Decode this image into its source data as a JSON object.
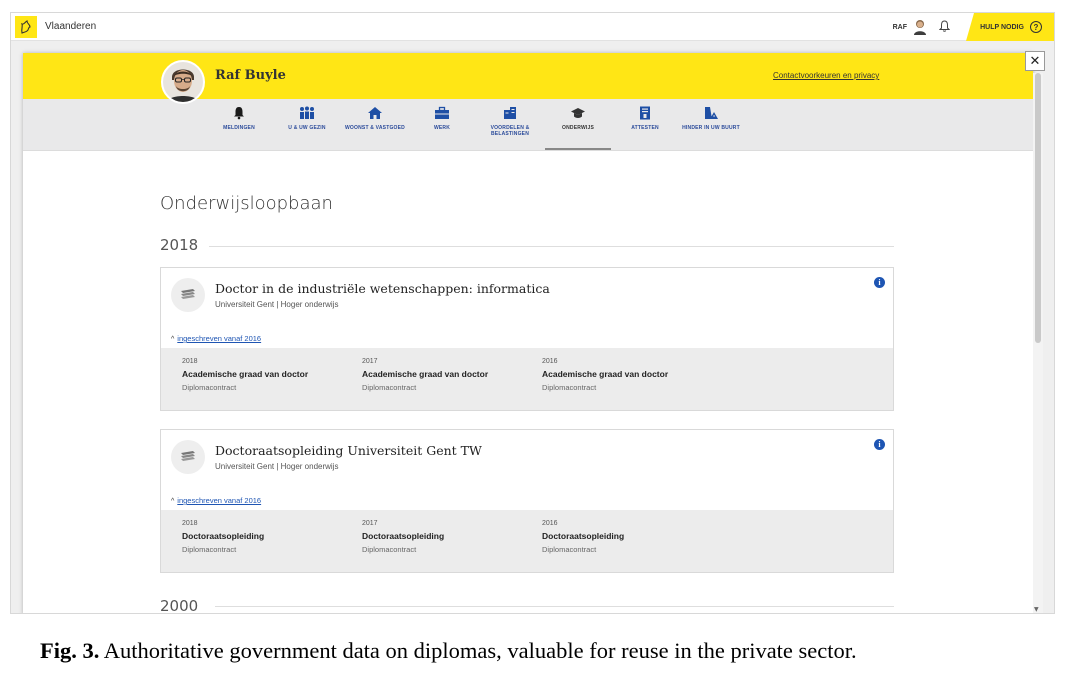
{
  "topbar": {
    "brand": "Vlaanderen",
    "user_short": "RAF",
    "help_label": "HULP NODIG",
    "help_icon": "?"
  },
  "profile": {
    "name": "Raf Buyle",
    "contact_link": "Contactvoorkeuren en privacy"
  },
  "nav": {
    "items": [
      {
        "label": "MELDINGEN",
        "icon": "bell-icon"
      },
      {
        "label": "U & UW GEZIN",
        "icon": "family-icon"
      },
      {
        "label": "WOONST & VASTGOED",
        "icon": "house-icon"
      },
      {
        "label": "WERK",
        "icon": "briefcase-icon"
      },
      {
        "label": "VOORDELEN & BELASTINGEN",
        "icon": "benefits-icon"
      },
      {
        "label": "ONDERWIJS",
        "icon": "graduation-cap-icon"
      },
      {
        "label": "ATTESTEN",
        "icon": "certificate-icon"
      },
      {
        "label": "HINDER IN UW BUURT",
        "icon": "roadwork-icon"
      }
    ],
    "active": "ONDERWIJS"
  },
  "main": {
    "title": "Onderwijsloopbaan",
    "years": [
      "2018",
      "2000"
    ],
    "cards": [
      {
        "title": "Doctor in de industriële wetenschappen: informatica",
        "subtitle": "Universiteit Gent | Hoger onderwijs",
        "toggle": "ingeschreven vanaf 2016",
        "details": [
          {
            "year": "2018",
            "title": "Academische graad van doctor",
            "type": "Diplomacontract"
          },
          {
            "year": "2017",
            "title": "Academische graad van doctor",
            "type": "Diplomacontract"
          },
          {
            "year": "2016",
            "title": "Academische graad van doctor",
            "type": "Diplomacontract"
          }
        ]
      },
      {
        "title": "Doctoraatsopleiding Universiteit Gent TW",
        "subtitle": "Universiteit Gent | Hoger onderwijs",
        "toggle": "ingeschreven vanaf 2016",
        "details": [
          {
            "year": "2018",
            "title": "Doctoraatsopleiding",
            "type": "Diplomacontract"
          },
          {
            "year": "2017",
            "title": "Doctoraatsopleiding",
            "type": "Diplomacontract"
          },
          {
            "year": "2016",
            "title": "Doctoraatsopleiding",
            "type": "Diplomacontract"
          }
        ]
      }
    ]
  },
  "caption": {
    "label": "Fig. 3.",
    "text": " Authoritative government data on diplomas, valuable for reuse in the private sector."
  },
  "colors": {
    "accent_yellow": "#ffe615",
    "nav_blue": "#1e4fa5",
    "link_blue": "#1e55b3"
  }
}
